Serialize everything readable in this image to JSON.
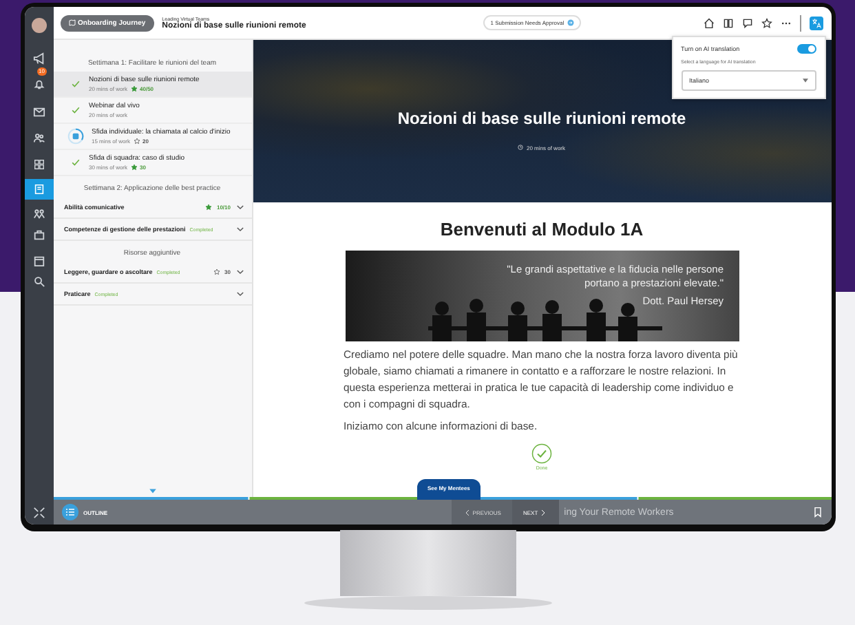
{
  "header": {
    "journey_chip": "Onboarding Journey",
    "breadcrumb": "Leading Virtual Teams",
    "title": "Nozioni di base sulle riunioni remote",
    "approval": "1 Submission Needs Approval"
  },
  "rail": {
    "notification_count": "10"
  },
  "translation": {
    "toggle_label": "Turn on AI translation",
    "on": true,
    "select_label": "Select a language for AI translation",
    "language": "Italiano"
  },
  "outline": {
    "sections": [
      {
        "title": "Settimana 1: Facilitare le riunioni del team",
        "items": [
          {
            "kind": "activity",
            "title": "Nozioni di base sulle riunioni remote",
            "meta": "20 mins of work",
            "score": "40/50",
            "star_filled": true,
            "done": true,
            "selected": true
          },
          {
            "kind": "activity",
            "title": "Webinar dal vivo",
            "meta": "20 mins of work",
            "done": true,
            "selected": false
          },
          {
            "kind": "activity",
            "title": "Sfida individuale: la chiamata al calcio d'inizio",
            "meta": "15 mins of work",
            "score": "20",
            "star_filled": false,
            "done": false,
            "selected": false
          },
          {
            "kind": "activity",
            "title": "Sfida di squadra: caso di studio",
            "meta": "30 mins of work",
            "score": "30",
            "star_filled": true,
            "done": true,
            "selected": false
          }
        ]
      },
      {
        "title": "Settimana 2: Applicazione delle best practice",
        "items": [
          {
            "kind": "module",
            "title": "Abilità comunicative",
            "score": "10/10",
            "star_filled": true
          },
          {
            "kind": "module",
            "title": "Competenze di gestione delle prestazioni",
            "tag": "Completed"
          }
        ]
      },
      {
        "title": "Risorse aggiuntive",
        "items": [
          {
            "kind": "module",
            "title": "Leggere, guardare o ascoltare",
            "tag": "Completed",
            "score": "30",
            "star_filled": false
          },
          {
            "kind": "module",
            "title": "Praticare",
            "tag": "Completed"
          }
        ]
      }
    ]
  },
  "hero": {
    "title": "Nozioni di base sulle riunioni remote",
    "meta": "20 mins of work"
  },
  "content": {
    "heading": "Benvenuti al Modulo 1A",
    "quote": "\"Le grandi aspettative e la fiducia nelle persone portano a prestazioni elevate.\"",
    "quote_author": "Dott. Paul Hersey",
    "paragraphs": [
      "Crediamo nel potere delle squadre. Man mano che la nostra forza lavoro diventa più globale, siamo chiamati a rimanere in contatto e a rafforzare le nostre relazioni. In questa esperienza metterai in pratica le tue capacità di leadership come individuo e con i compagni di squadra.",
      "Iniziamo con alcune informazioni di base."
    ],
    "done_label": "Done"
  },
  "mentees_button": "See My Mentees",
  "footer": {
    "outline_label": "OUTLINE",
    "previous": "PREVIOUS",
    "next": "NEXT",
    "behind_text": "ing Your Remote Workers"
  }
}
